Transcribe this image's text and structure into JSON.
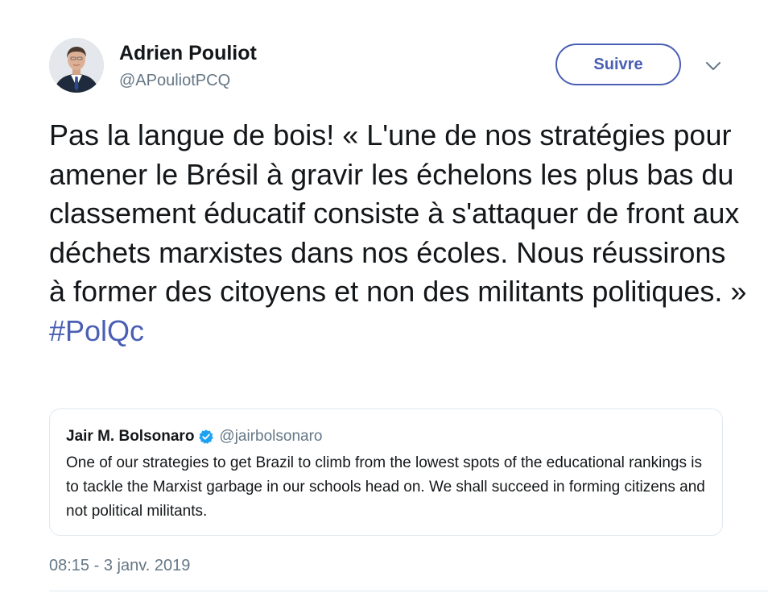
{
  "author": {
    "name": "Adrien Pouliot",
    "handle": "@APouliotPCQ"
  },
  "follow_button_label": "Suivre",
  "menu_icon": "chevron-down-icon",
  "tweet": {
    "text": "Pas la langue de bois! « L'une de nos stratégies pour amener le Brésil à gravir les échelons les plus bas du classement éducatif consiste à s'attaquer de front aux déchets marxistes dans nos écoles. Nous réussirons à former des citoyens et non des militants politiques. »",
    "hashtag": "#PolQc"
  },
  "quoted_tweet": {
    "author_name": "Jair M. Bolsonaro",
    "verified_icon": "verified-badge-icon",
    "author_handle": "@jairbolsonaro",
    "text": "One of our strategies to get Brazil to climb from the lowest spots of the educational rankings is to tackle the Marxist garbage in our schools head on. We shall succeed in forming citizens and not political militants."
  },
  "timestamp": "08:15 - 3 janv. 2019",
  "colors": {
    "accent": "#4a5fb3",
    "text_primary": "#14171a",
    "text_secondary": "#657786",
    "border": "#e1e8ed",
    "verified": "#1da1f2"
  }
}
